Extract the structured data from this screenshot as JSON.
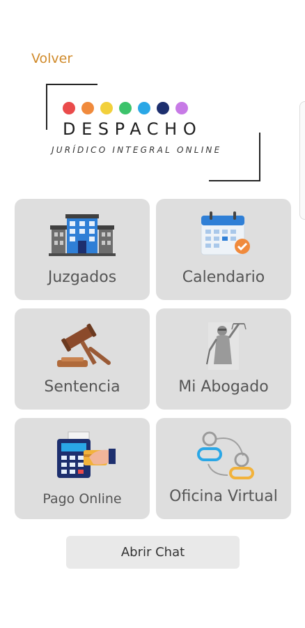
{
  "header": {
    "back_label": "Volver"
  },
  "logo": {
    "title": "DESPACHO",
    "subtitle": "JURÍDICO INTEGRAL ONLINE",
    "dot_colors": [
      "#ea4b4b",
      "#f08a3c",
      "#f2d03b",
      "#3cc36b",
      "#2aa7e6",
      "#1d2f6e",
      "#c77ae6"
    ]
  },
  "menu": {
    "items": [
      {
        "label": "Juzgados",
        "icon": "courthouse-building-icon"
      },
      {
        "label": "Calendario",
        "icon": "calendar-check-icon"
      },
      {
        "label": "Sentencia",
        "icon": "gavel-icon"
      },
      {
        "label": "Mi Abogado",
        "icon": "lady-justice-icon"
      },
      {
        "label": "Pago Online",
        "icon": "card-payment-terminal-icon"
      },
      {
        "label": "Oficina Virtual",
        "icon": "connected-users-icon"
      }
    ]
  },
  "chat": {
    "button_label": "Abrir Chat"
  },
  "colors": {
    "accent": "#d08a2a",
    "tile_bg": "#dedede",
    "text": "#555555"
  }
}
